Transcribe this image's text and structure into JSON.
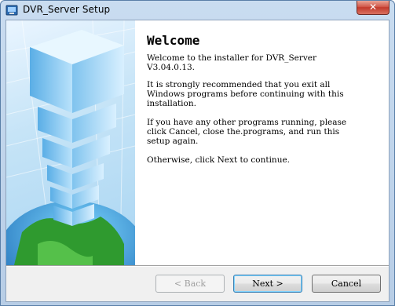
{
  "window": {
    "title": "DVR_Server Setup",
    "close_glyph": "✕"
  },
  "content": {
    "heading": "Welcome",
    "paragraphs": [
      "Welcome to the installer for DVR_Server\nV3.04.0.13.",
      "It is strongly recommended that you exit all\nWindows programs before continuing with this\ninstallation.",
      "If you have any other programs running, please\nclick Cancel, close the.programs, and run this\nsetup again.",
      "Otherwise, click Next to continue."
    ]
  },
  "buttons": {
    "back": "< Back",
    "next": "Next >",
    "cancel": "Cancel",
    "back_enabled": false
  },
  "icons": {
    "app": "installer-app-icon",
    "side": "tower-globe-illustration"
  },
  "colors": {
    "titlebar": "#c9dcf0",
    "close": "#c23a2c",
    "panel": "#a9d5f2",
    "globe_green": "#2f9a2f"
  }
}
